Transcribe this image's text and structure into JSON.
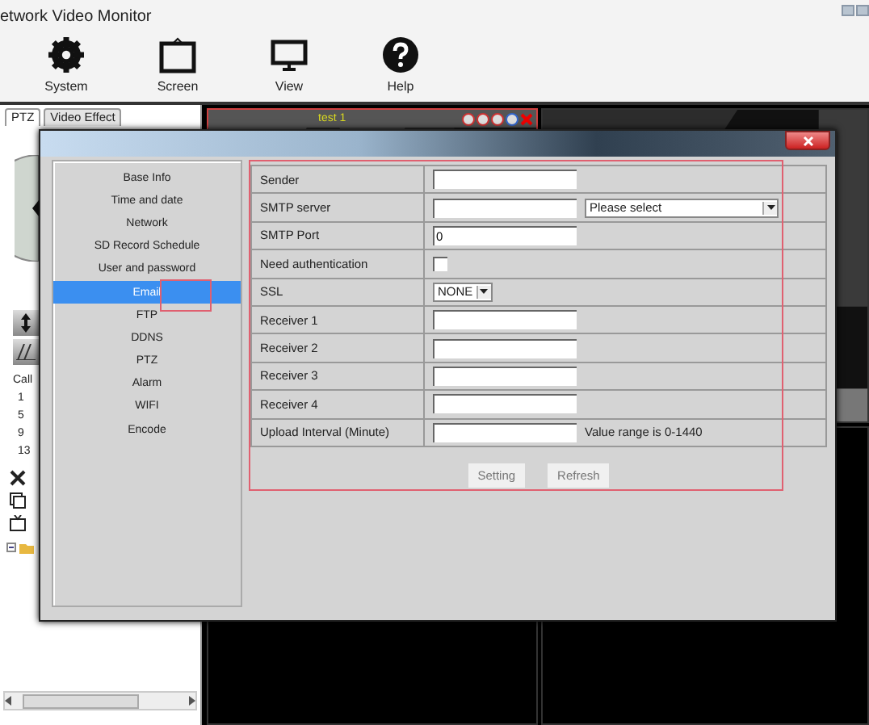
{
  "app": {
    "title": "etwork Video Monitor"
  },
  "toolbar": [
    {
      "label": "System"
    },
    {
      "label": "Screen"
    },
    {
      "label": "View"
    },
    {
      "label": "Help"
    }
  ],
  "left_panel": {
    "tabs": [
      {
        "label": "PTZ",
        "selected": true
      },
      {
        "label": "Video Effect",
        "selected": false
      }
    ],
    "call_label": "Call",
    "presets": [
      "1",
      "5",
      "9",
      "13"
    ]
  },
  "video": {
    "tile_title": "test 1"
  },
  "dialog": {
    "menu": [
      {
        "label": "Base Info",
        "selected": false
      },
      {
        "label": "Time and date",
        "selected": false
      },
      {
        "label": "Network",
        "selected": false
      },
      {
        "label": "SD Record Schedule",
        "selected": false
      },
      {
        "label": "User and password",
        "selected": false
      },
      {
        "label": "Email",
        "selected": true
      },
      {
        "label": "FTP",
        "selected": false
      },
      {
        "label": "DDNS",
        "selected": false
      },
      {
        "label": "PTZ",
        "selected": false
      },
      {
        "label": "Alarm",
        "selected": false
      },
      {
        "label": "WIFI",
        "selected": false
      },
      {
        "label": "Encode",
        "selected": false
      }
    ],
    "fields": [
      {
        "label": "Sender",
        "kind": "text"
      },
      {
        "label": "SMTP server",
        "kind": "text_select",
        "select": "Please select"
      },
      {
        "label": "SMTP Port",
        "kind": "text",
        "value": "0"
      },
      {
        "label": "Need authentication",
        "kind": "checkbox",
        "checked": false
      },
      {
        "label": "SSL",
        "kind": "select",
        "select": "NONE"
      },
      {
        "label": "Receiver 1",
        "kind": "text"
      },
      {
        "label": "Receiver 2",
        "kind": "text"
      },
      {
        "label": "Receiver 3",
        "kind": "text"
      },
      {
        "label": "Receiver 4",
        "kind": "text"
      },
      {
        "label": "Upload Interval (Minute)",
        "kind": "text",
        "note": "Value range is 0-1440"
      }
    ],
    "buttons": [
      {
        "label": "Setting"
      },
      {
        "label": "Refresh"
      }
    ]
  }
}
